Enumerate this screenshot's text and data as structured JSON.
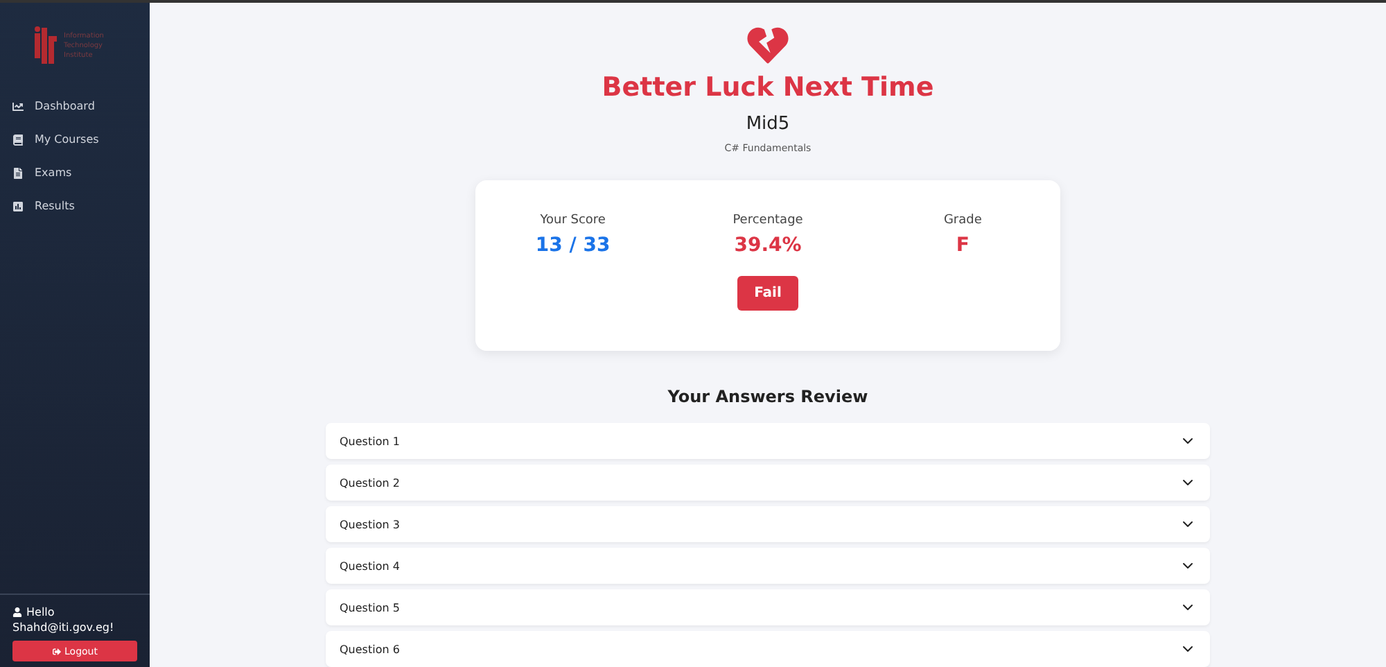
{
  "sidebar": {
    "logo": {
      "lines": [
        "Information",
        "Technology",
        "Institute"
      ]
    },
    "items": [
      {
        "label": "Dashboard",
        "kind": "chart",
        "selected": false
      },
      {
        "label": "My Courses",
        "kind": "book",
        "selected": false
      },
      {
        "label": "Exams",
        "kind": "file",
        "selected": false
      },
      {
        "label": "Results",
        "kind": "poll",
        "selected": false
      }
    ],
    "user": {
      "greeting": "Hello",
      "email": "Shahd@iti.gov.eg!"
    },
    "logout": "Logout"
  },
  "result": {
    "title": "Better Luck Next Time",
    "exam": "Mid5",
    "course": "C# Fundamentals",
    "passed": false,
    "stats": [
      {
        "label": "Your Score",
        "value": "13 / 33",
        "color": "#1a73e8"
      },
      {
        "label": "Percentage",
        "value": "39.4%",
        "color": "#dc3545"
      },
      {
        "label": "Grade",
        "value": "F",
        "color": "#dc3545"
      }
    ],
    "status": "Fail"
  },
  "review": {
    "title": "Your Answers Review",
    "questions": [
      {
        "label": "Question 1",
        "expanded": false
      },
      {
        "label": "Question 2",
        "expanded": false
      },
      {
        "label": "Question 3",
        "expanded": false
      },
      {
        "label": "Question 4",
        "expanded": false
      },
      {
        "label": "Question 5",
        "expanded": false
      },
      {
        "label": "Question 6",
        "expanded": false
      }
    ]
  }
}
